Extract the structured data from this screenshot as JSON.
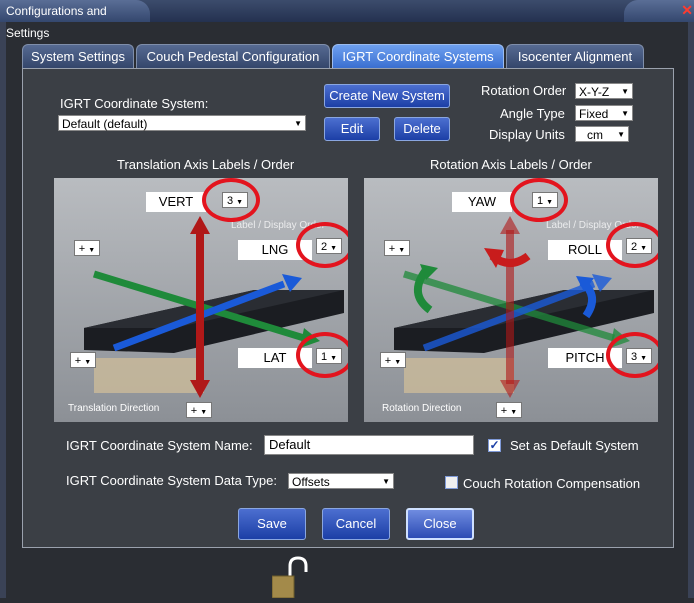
{
  "window": {
    "title": "Configurations and Settings"
  },
  "tabs": [
    {
      "label": "System Settings"
    },
    {
      "label": "Couch Pedestal Configuration"
    },
    {
      "label": "IGRT Coordinate Systems"
    },
    {
      "label": "Isocenter Alignment"
    }
  ],
  "coord_system": {
    "label": "IGRT Coordinate System:",
    "value": "Default (default)"
  },
  "buttons": {
    "create": "Create New System",
    "edit": "Edit",
    "delete": "Delete",
    "save": "Save",
    "cancel": "Cancel",
    "close": "Close"
  },
  "rotation_order": {
    "label": "Rotation Order",
    "value": "X-Y-Z"
  },
  "angle_type": {
    "label": "Angle Type",
    "value": "Fixed"
  },
  "display_units": {
    "label": "Display Units",
    "value": "cm"
  },
  "translation": {
    "heading": "Translation Axis Labels / Order",
    "vert": {
      "label": "VERT",
      "order": "3"
    },
    "lng": {
      "label": "LNG",
      "order": "2"
    },
    "lat": {
      "label": "LAT",
      "order": "1"
    },
    "overlay": "Label / Display Order",
    "direction_label": "Translation Direction",
    "sign": "+"
  },
  "rotation": {
    "heading": "Rotation Axis Labels / Order",
    "yaw": {
      "label": "YAW",
      "order": "1"
    },
    "roll": {
      "label": "ROLL",
      "order": "2"
    },
    "pitch": {
      "label": "PITCH",
      "order": "3"
    },
    "overlay": "Label / Display Order",
    "direction_label": "Rotation Direction",
    "sign": "+"
  },
  "name_field": {
    "label": "IGRT Coordinate System Name:",
    "value": "Default"
  },
  "default_checkbox": {
    "label": "Set as Default System",
    "checked": true
  },
  "data_type": {
    "label": "IGRT Coordinate System Data Type:",
    "value": "Offsets"
  },
  "compensation_checkbox": {
    "label": "Couch Rotation Compensation",
    "checked": false
  },
  "colors": {
    "accent": "#3a6fd0",
    "highlight_ring": "#e3141e",
    "arrow_red": "#b01818",
    "arrow_green": "#1f8a3a",
    "arrow_blue": "#1a5ad8"
  }
}
